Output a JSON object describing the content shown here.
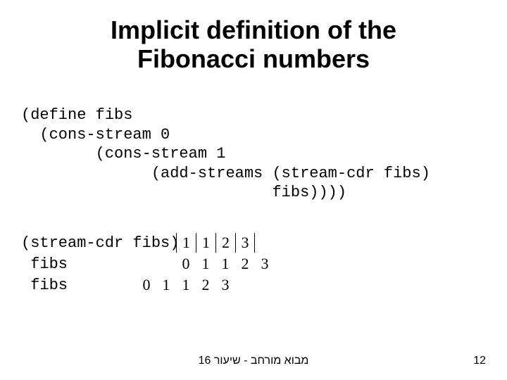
{
  "title_line1": "Implicit definition of the",
  "title_line2": "Fibonacci numbers",
  "code": {
    "l1": "(define fibs",
    "l2": "  (cons-stream 0",
    "l3": "        (cons-stream 1",
    "l4": "              (add-streams (stream-cdr fibs)",
    "l5": "                           fibs))))"
  },
  "rows": {
    "r1": {
      "label": "(stream-cdr fibs)",
      "offset": 0,
      "cells": [
        "1",
        "1",
        "2",
        "3"
      ]
    },
    "r2": {
      "label": " fibs",
      "offset": 0,
      "cells": [
        "0",
        "1",
        "1",
        "2",
        "3"
      ]
    },
    "r3": {
      "label": " fibs",
      "offset": -2,
      "cells": [
        "0",
        "1",
        "1",
        "2",
        "3"
      ]
    }
  },
  "footer_center": "מבוא מורחב - שיעור 16",
  "page_number": "12"
}
